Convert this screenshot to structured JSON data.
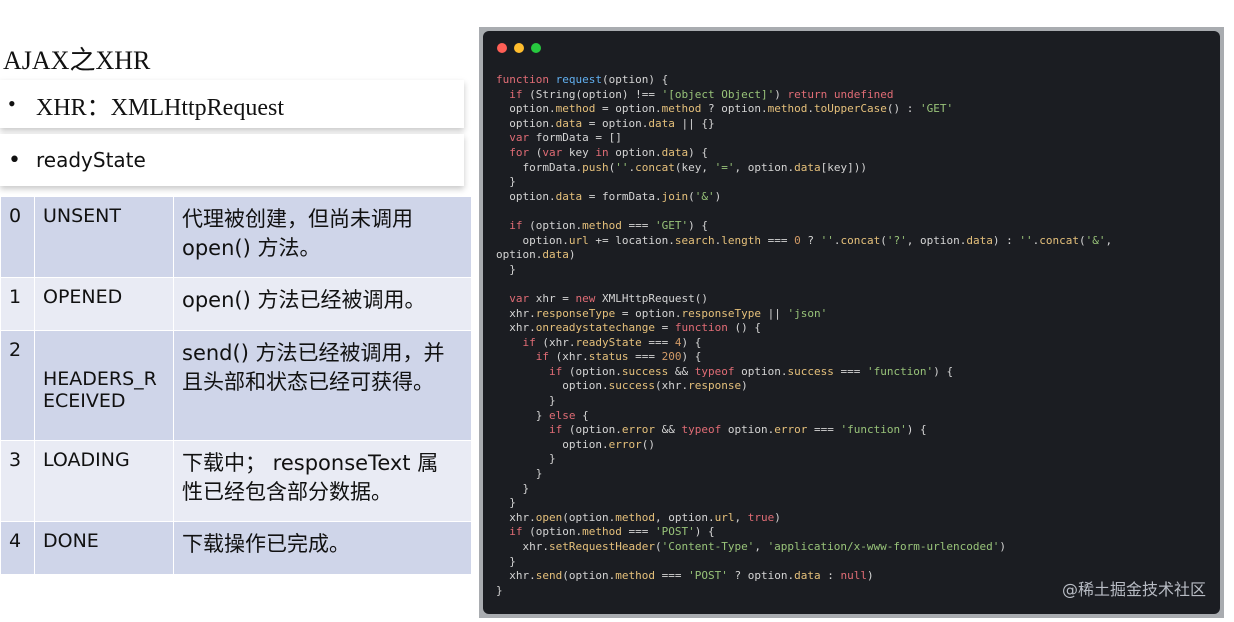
{
  "title": "AJAX之XHR",
  "bullets": [
    {
      "text": "XHR：XMLHttpRequest"
    },
    {
      "text": "readyState"
    }
  ],
  "states": [
    {
      "num": "0",
      "name": "UNSENT",
      "desc": "代理被创建，但尚未调用 open() 方法。"
    },
    {
      "num": "1",
      "name": "OPENED",
      "desc": "open() 方法已经被调用。"
    },
    {
      "num": "2",
      "name": "HEADERS_RECEIVED",
      "desc": "send() 方法已经被调用，并且头部和状态已经可获得。"
    },
    {
      "num": "3",
      "name": "LOADING",
      "desc": "下载中； responseText 属性已经包含部分数据。"
    },
    {
      "num": "4",
      "name": "DONE",
      "desc": "下载操作已完成。"
    }
  ],
  "code": {
    "lines": [
      "function request(option) {",
      "  if (String(option) !== '[object Object]') return undefined",
      "  option.method = option.method ? option.method.toUpperCase() : 'GET'",
      "  option.data = option.data || {}",
      "  var formData = []",
      "  for (var key in option.data) {",
      "    formData.push(''.concat(key, '=', option.data[key]))",
      "  }",
      "  option.data = formData.join('&')",
      "",
      "  if (option.method === 'GET') {",
      "    option.url += location.search.length === 0 ? ''.concat('?', option.data) : ''.concat('&',",
      "option.data)",
      "  }",
      "",
      "  var xhr = new XMLHttpRequest()",
      "  xhr.responseType = option.responseType || 'json'",
      "  xhr.onreadystatechange = function () {",
      "    if (xhr.readyState === 4) {",
      "      if (xhr.status === 200) {",
      "        if (option.success && typeof option.success === 'function') {",
      "          option.success(xhr.response)",
      "        }",
      "      } else {",
      "        if (option.error && typeof option.error === 'function') {",
      "          option.error()",
      "        }",
      "      }",
      "    }",
      "  }",
      "  xhr.open(option.method, option.url, true)",
      "  if (option.method === 'POST') {",
      "    xhr.setRequestHeader('Content-Type', 'application/x-www-form-urlencoded')",
      "  }",
      "  xhr.send(option.method === 'POST' ? option.data : null)",
      "}"
    ]
  },
  "watermark": "@稀土掘金技术社区",
  "colors": {
    "keyword": "#e06c75",
    "function_name": "#61afef",
    "property": "#e5c07b",
    "string": "#98c379",
    "number": "#d19a66",
    "plain": "#d4d4d4",
    "table_dark": "#cfd5e9",
    "table_light": "#e9ebf4"
  }
}
